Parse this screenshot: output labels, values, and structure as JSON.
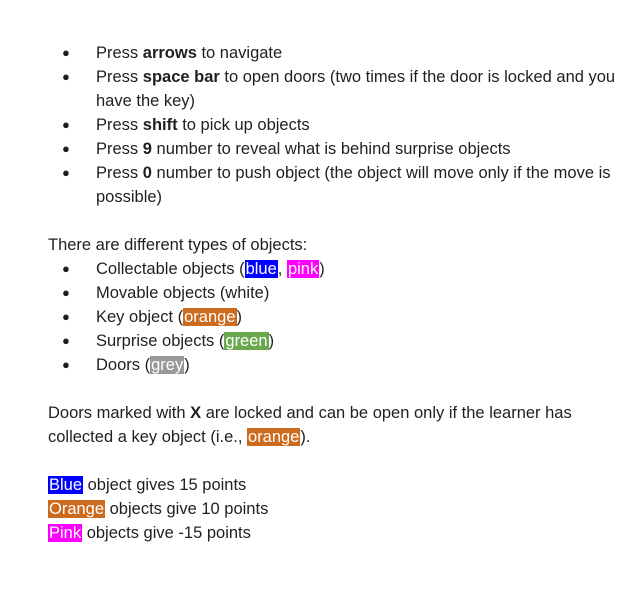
{
  "controls": [
    {
      "pre": "Press ",
      "key": "arrows",
      "post": " to navigate"
    },
    {
      "pre": "Press ",
      "key": "space bar",
      "post": " to open doors (two times if the door is locked and you have the key)"
    },
    {
      "pre": "Press ",
      "key": "shift",
      "post": " to pick up objects"
    },
    {
      "pre": "Press ",
      "key": "9",
      "post": " number to reveal what is behind surprise objects"
    },
    {
      "pre": "Press ",
      "key": "0",
      "post": " number to push object (the object will move only if the move is possible)"
    }
  ],
  "objects_intro": "There are different types of objects:",
  "objects": {
    "collectable": {
      "pre": "Collectable objects (",
      "hl1": "blue",
      "sep": ", ",
      "hl2": "pink",
      "post": ")"
    },
    "movable": {
      "text": "Movable objects (white)"
    },
    "key": {
      "pre": "Key object (",
      "hl": "orange",
      "post": ")"
    },
    "surprise": {
      "pre": "Surprise objects (",
      "hl": "green",
      "post": ")"
    },
    "doors": {
      "pre": "Doors (",
      "hl": "grey",
      "post": ")"
    }
  },
  "doors_note": {
    "pre": "Doors marked with ",
    "mark": "X",
    "mid": " are locked and can be open only if the learner has collected a key object (i.e., ",
    "hl": "orange",
    "post": ")."
  },
  "points": [
    {
      "hl": "Blue",
      "text": " object gives 15 points",
      "color": "#0000ff"
    },
    {
      "hl": "Orange",
      "text": " objects give 10 points",
      "color": "#cc6a1d"
    },
    {
      "hl": "Pink",
      "text": " objects give -15 points",
      "color": "#ff00ff"
    }
  ],
  "bullet_glyph": "●"
}
